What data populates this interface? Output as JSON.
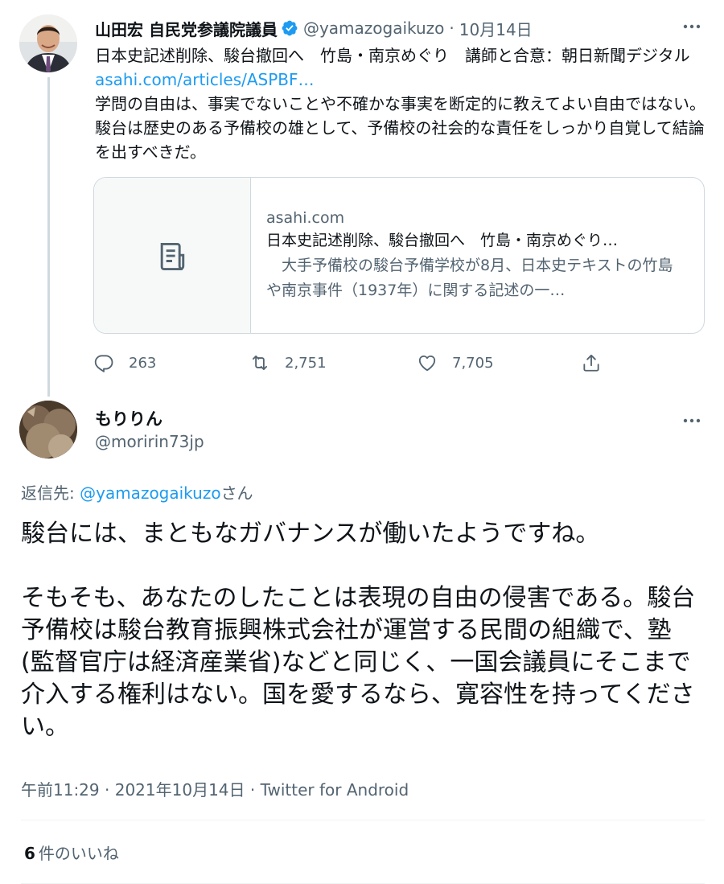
{
  "parent_tweet": {
    "author_name": "山田宏 自民党参議院議員",
    "handle": "@yamazogaikuzo",
    "separator": "·",
    "date": "10月14日",
    "more_icon": "more-horizontal-icon",
    "text_line1": "日本史記述削除、駿台撤回へ　竹島・南京めぐり　講師と合意：朝日新聞デジタル ",
    "link_text": "asahi.com/articles/ASPBF…",
    "text_para2": "学問の自由は、事実でないことや不確かな事実を断定的に教えてよい自由ではない。駿台は歴史のある予備校の雄として、予備校の社会的な責任をしっかり自覚して結論を出すべきだ。",
    "card": {
      "domain": "asahi.com",
      "title": "日本史記述削除、駿台撤回へ　竹島・南京めぐり…",
      "description": "　大手予備校の駿台予備学校が8月、日本史テキストの竹島や南京事件（1937年）に関する記述の一…",
      "thumb_icon": "article-icon"
    },
    "actions": {
      "replies": "263",
      "retweets": "2,751",
      "likes": "7,705"
    }
  },
  "reply_tweet": {
    "author_name": "もりりん",
    "handle": "@moririn73jp",
    "reply_to_prefix": "返信先: ",
    "reply_to_handle": "@yamazogaikuzo",
    "reply_to_suffix": "さん",
    "text_para1": "駿台には、まともなガバナンスが働いたようですね。",
    "text_para2": "そもそも、あなたのしたことは表現の自由の侵害である。駿台予備校は駿台教育振興株式会社が運営する民間の組織で、塾(監督官庁は経済産業省)などと同じく、一国会議員にそこまで介入する権利はない。国を愛するなら、寛容性を持ってください。",
    "time": "午前11:29",
    "separator": "·",
    "date": "2021年10月14日",
    "client": "Twitter for Android",
    "likes_count": "6",
    "likes_label": "件のいいね"
  },
  "colors": {
    "link": "#1d9bf0",
    "secondary_text": "#536471",
    "border": "#cfd9de",
    "verified_badge": "#1d9bf0"
  }
}
